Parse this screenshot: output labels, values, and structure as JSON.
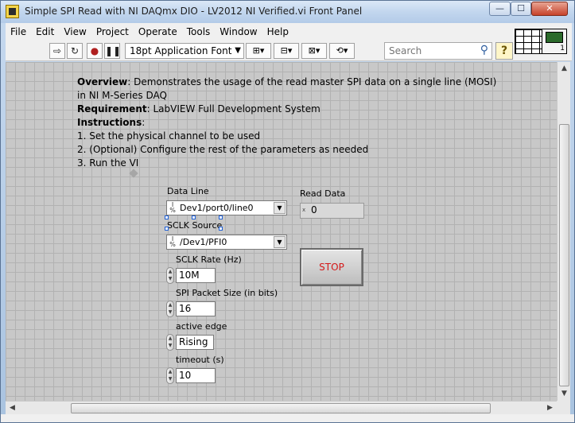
{
  "window": {
    "title": "Simple SPI Read with NI DAQmx DIO - LV2012 NI Verified.vi Front Panel",
    "controls": {
      "minimize": "—",
      "maximize": "☐",
      "close": "✕"
    }
  },
  "menu": [
    "File",
    "Edit",
    "View",
    "Project",
    "Operate",
    "Tools",
    "Window",
    "Help"
  ],
  "toolbar": {
    "font": "18pt Application Font",
    "search_placeholder": "Search",
    "help_label": "?",
    "vi_icon_number": "1"
  },
  "description": {
    "overview_label": "Overview",
    "overview_text": ": Demonstrates the usage of the read master SPI data on a single line (MOSI) in NI M-Series DAQ",
    "requirement_label": "Requirement",
    "requirement_text": ": LabVIEW Full Development System",
    "instructions_label": "Instructions",
    "instructions_colon": ":",
    "steps": [
      "1. Set the physical channel to be used",
      "2. (Optional) Configure the rest of the parameters as needed",
      "3. Run the VI"
    ]
  },
  "controls": {
    "data_line": {
      "label": "Data Line",
      "value": "Dev1/port0/line0"
    },
    "sclk_source": {
      "label": "SCLK Source",
      "value": "/Dev1/PFI0"
    },
    "sclk_rate": {
      "label": "SCLK Rate (Hz)",
      "value": "10M"
    },
    "packet_size": {
      "label": "SPI Packet Size (in bits)",
      "value": "16"
    },
    "active_edge": {
      "label": "active edge",
      "value": "Rising"
    },
    "timeout": {
      "label": "timeout (s)",
      "value": "10"
    },
    "read_data": {
      "label": "Read Data",
      "value": "0"
    },
    "stop": {
      "label": "STOP"
    }
  }
}
